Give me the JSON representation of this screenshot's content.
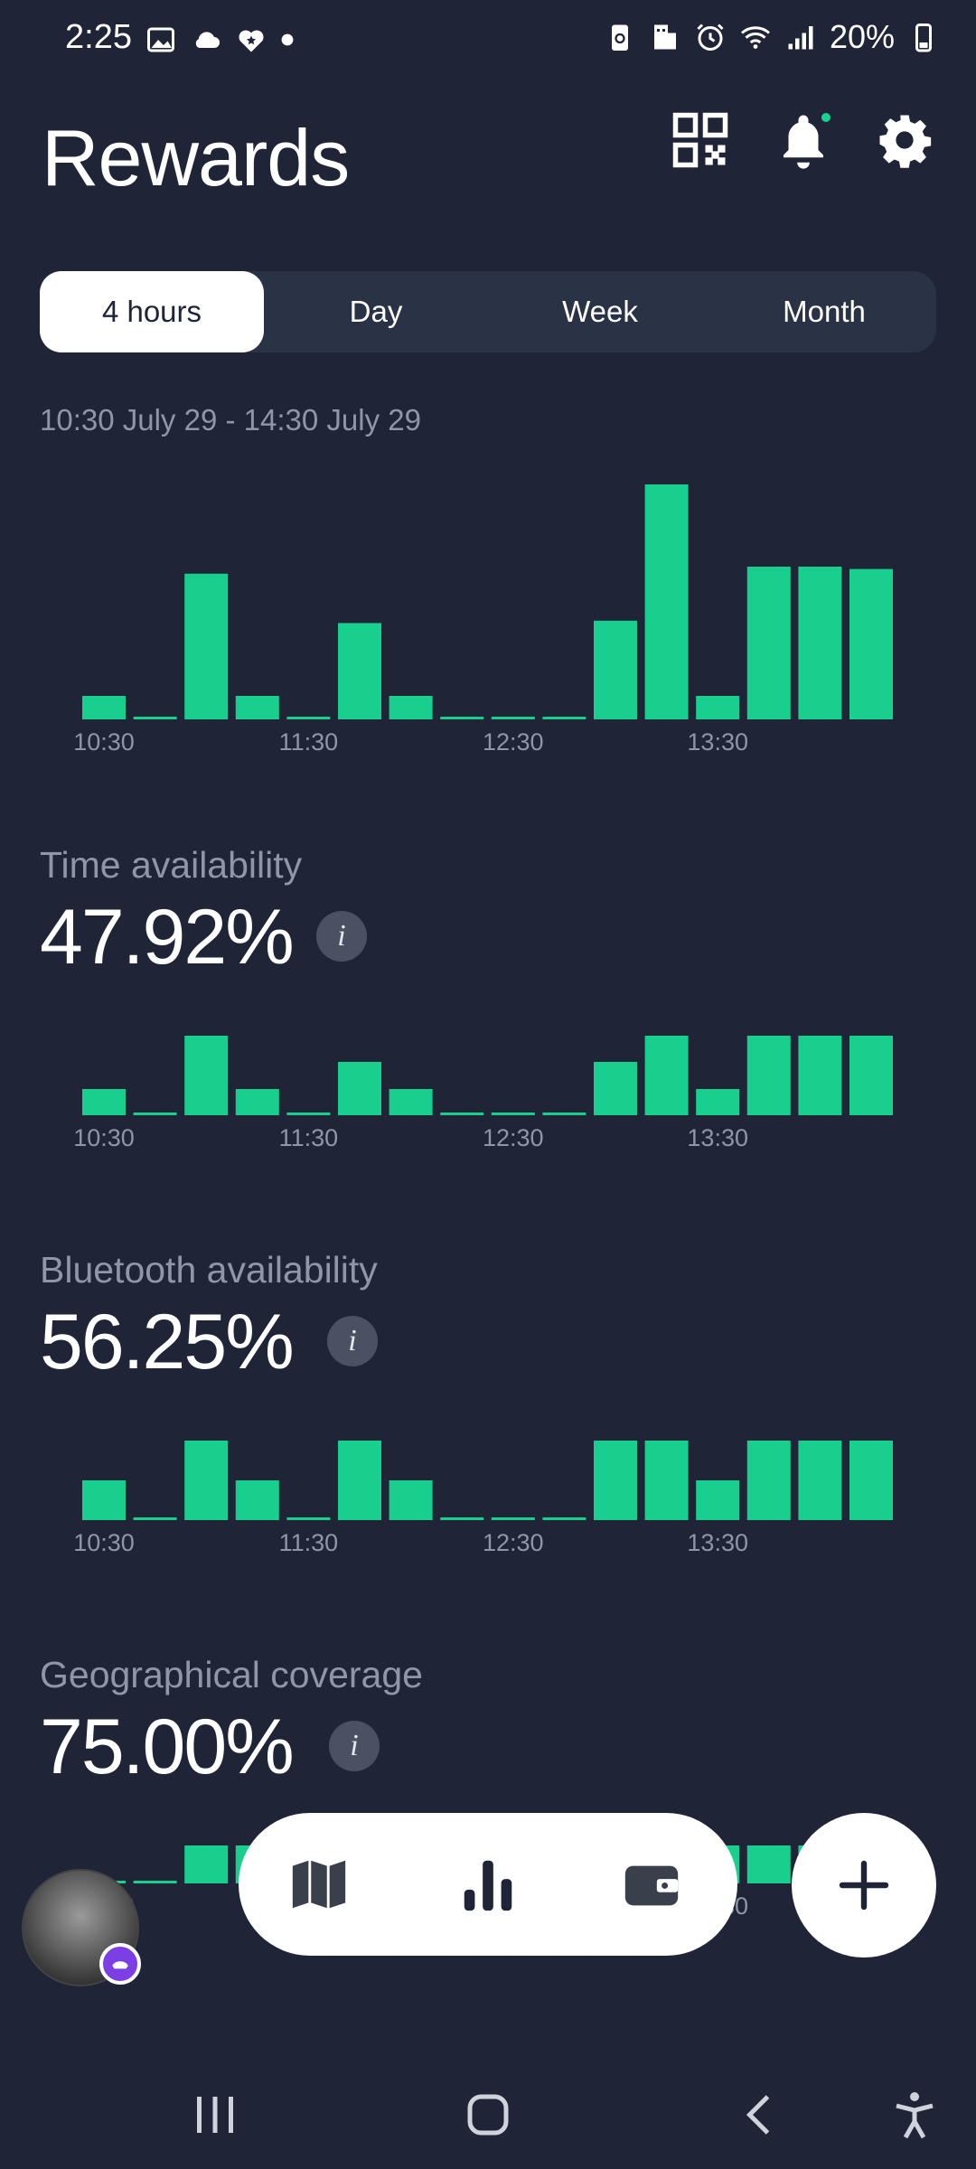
{
  "status_bar": {
    "time": "2:25",
    "battery": "20%"
  },
  "header": {
    "title": "Rewards"
  },
  "tabs": [
    {
      "label": "4 hours",
      "active": true
    },
    {
      "label": "Day",
      "active": false
    },
    {
      "label": "Week",
      "active": false
    },
    {
      "label": "Month",
      "active": false
    }
  ],
  "range_label": "10:30 July 29 - 14:30 July 29",
  "colors": {
    "background": "#1f2537",
    "bar": "#18cf8d",
    "muted_text": "#8e96a7",
    "segment_bg": "#2a3246"
  },
  "metrics": [
    {
      "label": "Time availability",
      "value": "47.92%"
    },
    {
      "label": "Bluetooth availability",
      "value": "56.25%"
    },
    {
      "label": "Geographical coverage",
      "value": "75.00%"
    }
  ],
  "info_glyph": "i",
  "chart_data": [
    {
      "type": "bar",
      "x_tick_labels": [
        "10:30",
        "11:30",
        "12:30",
        "13:30"
      ],
      "values": [
        10,
        1,
        62,
        10,
        1,
        41,
        10,
        1,
        1,
        1,
        42,
        100,
        10,
        65,
        65,
        64
      ]
    },
    {
      "type": "bar",
      "x_tick_labels": [
        "10:30",
        "11:30",
        "12:30",
        "13:30"
      ],
      "values": [
        33,
        2,
        100,
        33,
        2,
        67,
        33,
        2,
        2,
        2,
        67,
        100,
        33,
        100,
        100,
        100
      ]
    },
    {
      "type": "bar",
      "x_tick_labels": [
        "10:30",
        "11:30",
        "12:30",
        "13:30"
      ],
      "values": [
        50,
        2,
        100,
        50,
        2,
        100,
        50,
        2,
        2,
        2,
        100,
        100,
        50,
        100,
        100,
        100
      ]
    },
    {
      "type": "bar",
      "x_tick_labels": [
        "10:30",
        "11:30",
        "12:30",
        "13:30"
      ],
      "values": [
        2,
        2,
        100,
        100,
        2,
        100,
        100,
        2,
        2,
        2,
        100,
        100,
        100,
        100,
        100,
        100
      ]
    }
  ],
  "nav": {
    "icons": [
      "map-icon",
      "bar-chart-icon",
      "wallet-icon"
    ],
    "fab_icon": "plus-icon"
  }
}
